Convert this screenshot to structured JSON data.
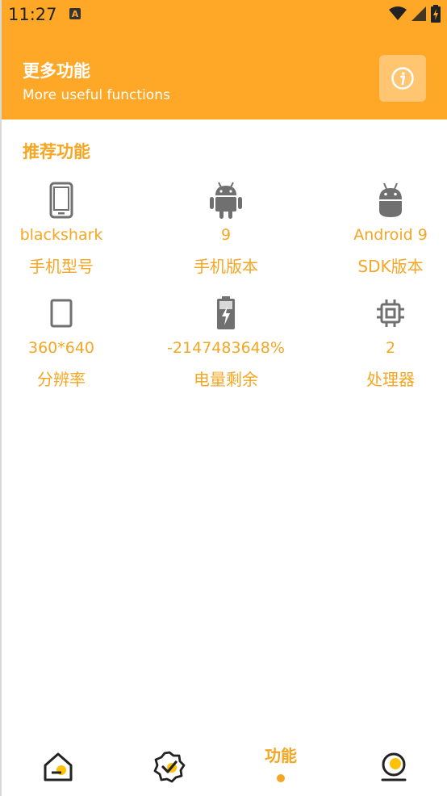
{
  "status_bar": {
    "time": "11:27",
    "notif_letter": "A"
  },
  "header": {
    "title": "更多功能",
    "subtitle": "More useful functions"
  },
  "section": {
    "title": "推荐功能"
  },
  "items": [
    {
      "icon": "phone-icon",
      "value": "blackshark",
      "label": "手机型号"
    },
    {
      "icon": "android-icon",
      "value": "9",
      "label": "手机版本"
    },
    {
      "icon": "android-head-icon",
      "value": "Android 9",
      "label": "SDK版本"
    },
    {
      "icon": "screen-icon",
      "value": "360*640",
      "label": "分辨率"
    },
    {
      "icon": "battery-charging-icon",
      "value": "-2147483648%",
      "label": "电量剩余"
    },
    {
      "icon": "cpu-icon",
      "value": "2",
      "label": "处理器"
    }
  ],
  "bottom_nav": {
    "active_label": "功能",
    "items": [
      "home-icon",
      "verified-badge-icon",
      "features-tab",
      "profile-icon"
    ]
  },
  "colors": {
    "accent": "#FFA726",
    "text_accent": "#F5A623",
    "icon_gray": "#707070"
  }
}
